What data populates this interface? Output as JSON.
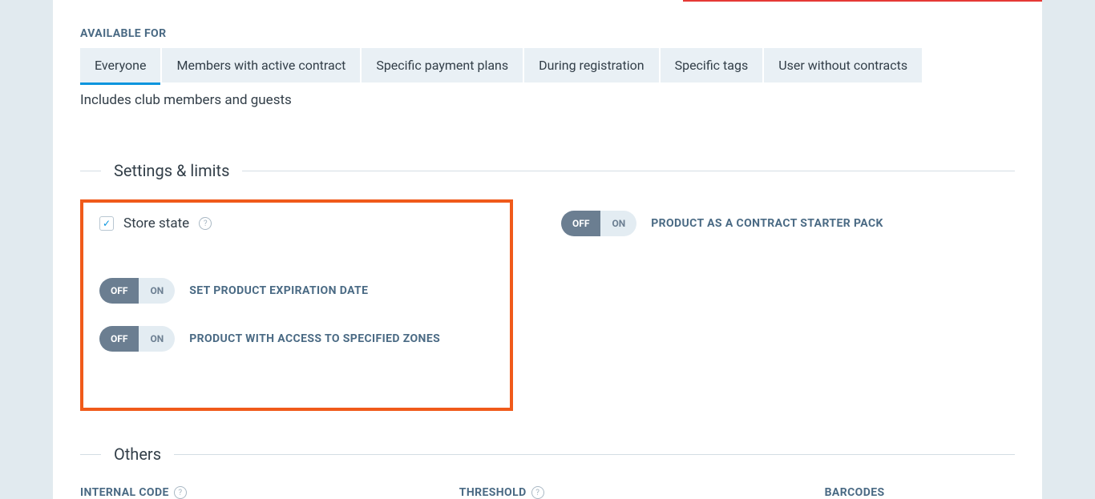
{
  "available_for": {
    "label": "AVAILABLE FOR",
    "tabs": {
      "everyone": "Everyone",
      "members_active": "Members with active contract",
      "specific_plans": "Specific payment plans",
      "during_registration": "During registration",
      "specific_tags": "Specific tags",
      "user_without_contracts": "User without contracts"
    },
    "description": "Includes club members and guests"
  },
  "settings_limits": {
    "title": "Settings & limits",
    "store_state_label": "Store state",
    "toggle_off": "OFF",
    "toggle_on": "ON",
    "expiration_label": "SET PRODUCT EXPIRATION DATE",
    "zones_label": "PRODUCT WITH ACCESS TO SPECIFIED ZONES",
    "starter_pack_label": "PRODUCT AS A CONTRACT STARTER PACK"
  },
  "others": {
    "title": "Others",
    "internal_code_label": "INTERNAL CODE",
    "threshold_label": "THRESHOLD",
    "barcodes_label": "BARCODES"
  }
}
